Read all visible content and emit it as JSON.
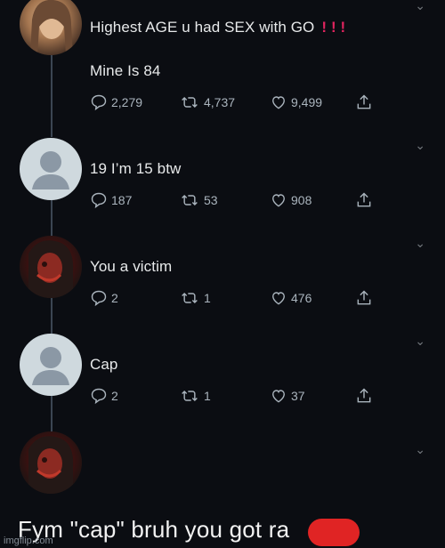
{
  "tweets": [
    {
      "lines": [
        "Highest AGE u had SEX with GO",
        "Mine Is 84"
      ],
      "marks": "! ! !",
      "replies": "2,279",
      "retweets": "4,737",
      "likes": "9,499"
    },
    {
      "lines": [
        "19 I’m 15 btw"
      ],
      "replies": "187",
      "retweets": "53",
      "likes": "908"
    },
    {
      "lines": [
        "You a victim"
      ],
      "replies": "2",
      "retweets": "1",
      "likes": "476"
    },
    {
      "lines": [
        "Cap"
      ],
      "replies": "2",
      "retweets": "1",
      "likes": "37"
    }
  ],
  "last_tweet_text": "Fym \"cap\" bruh you got ra",
  "watermark": "imgflip.com",
  "icons": {
    "reply": "reply-icon",
    "retweet": "retweet-icon",
    "like": "heart-icon",
    "share": "share-icon",
    "caret": "chevron-down-icon"
  },
  "colors": {
    "background": "#0b0d12",
    "text": "#e7e9ea",
    "muted": "#aab4bd",
    "accent_red": "#e0245e"
  }
}
